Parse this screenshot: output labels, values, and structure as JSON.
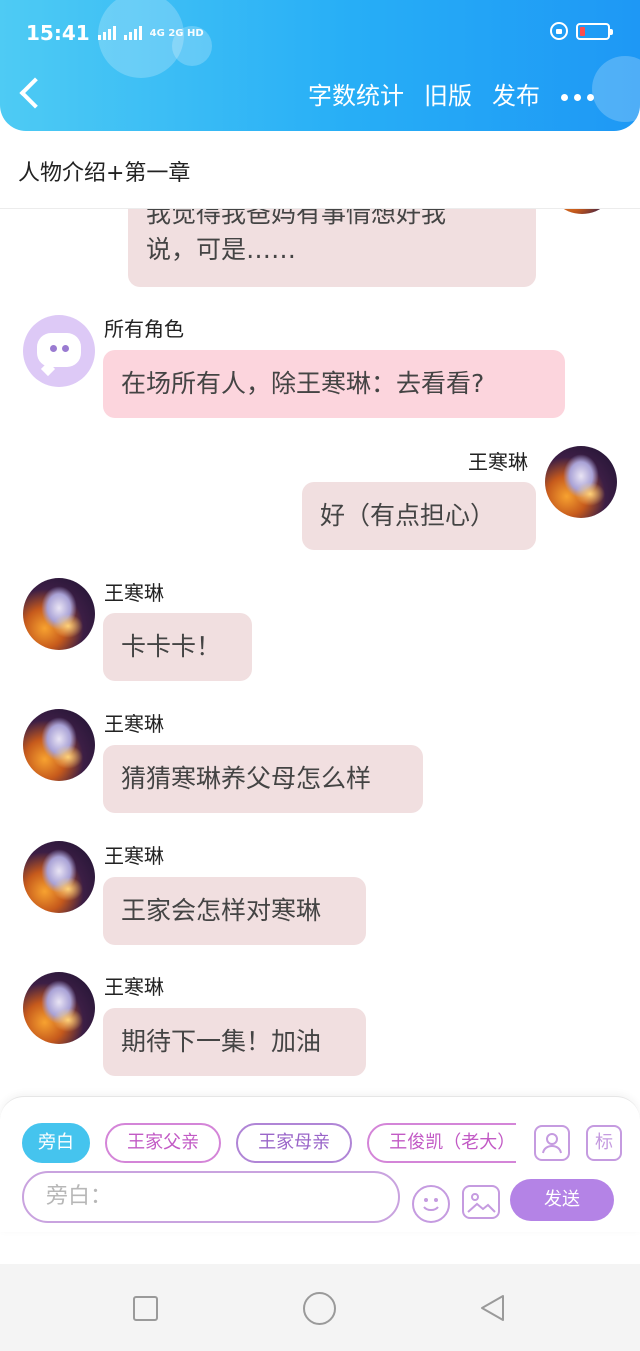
{
  "status_bar": {
    "time": "15:41",
    "network": "4G 2G HD"
  },
  "header": {
    "actions": [
      "字数统计",
      "旧版",
      "发布"
    ],
    "accent_gradient": [
      "#4ecbf4",
      "#1e98f5"
    ]
  },
  "title": "人物介绍+第一章",
  "messages": [
    {
      "side": "right",
      "speaker": "",
      "text_line1": "我觉得我爸妈有事情想好我",
      "text_line2": "说，可是……"
    },
    {
      "side": "left",
      "speaker": "所有角色",
      "text": "在场所有人，除王寒琳：去看看?",
      "avatar": "system-chat-icon"
    },
    {
      "side": "right",
      "speaker": "王寒琳",
      "text": "好（有点担心）"
    },
    {
      "side": "left",
      "speaker": "王寒琳",
      "text": "卡卡卡！"
    },
    {
      "side": "left",
      "speaker": "王寒琳",
      "text": "猜猜寒琳养父母怎么样"
    },
    {
      "side": "left",
      "speaker": "王寒琳",
      "text": "王家会怎样对寒琳"
    },
    {
      "side": "left",
      "speaker": "王寒琳",
      "text": "期待下一集！加油"
    }
  ],
  "role_chips": [
    "旁白",
    "王家父亲",
    "王家母亲",
    "王俊凯（老大）"
  ],
  "tool_icon_label": "标",
  "input": {
    "placeholder": "旁白："
  },
  "send_label": "发送"
}
